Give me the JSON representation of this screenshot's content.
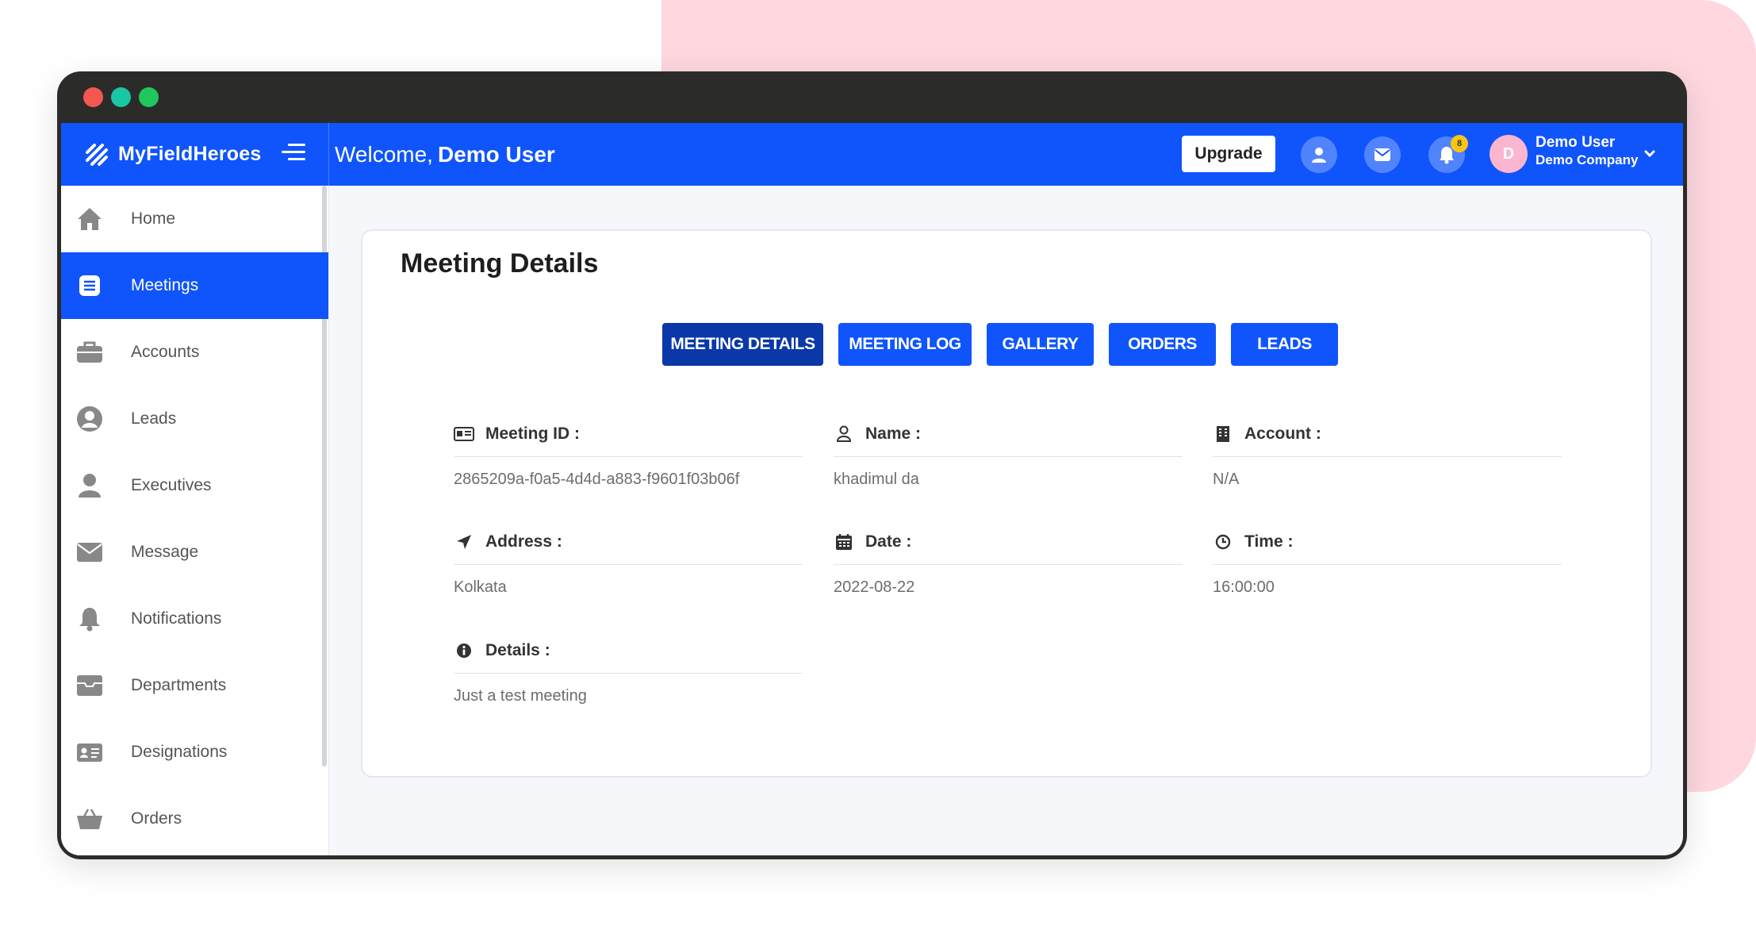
{
  "colors": {
    "brand_blue": "#0f55fb",
    "active_tab": "#0a38a8",
    "pink_bg": "#fed7df",
    "window_frame": "#2b2c2a",
    "badge": "#f9c514"
  },
  "window": {
    "traffic_lights": [
      "#f4574f",
      "#18c8a4",
      "#1fc85c"
    ]
  },
  "topbar": {
    "brand": "MyFieldHeroes",
    "welcome_prefix": "Welcome,",
    "welcome_name": "Demo User",
    "upgrade_label": "Upgrade",
    "icons": [
      "user-icon",
      "mail-icon",
      "bell-icon"
    ],
    "notification_count": "8",
    "avatar_initial": "D",
    "user_name": "Demo User",
    "company": "Demo Company"
  },
  "sidebar": {
    "items": [
      {
        "label": "Home",
        "icon": "home-icon"
      },
      {
        "label": "Meetings",
        "icon": "meetings-icon",
        "active": true
      },
      {
        "label": "Accounts",
        "icon": "briefcase-icon"
      },
      {
        "label": "Leads",
        "icon": "user-circle-icon"
      },
      {
        "label": "Executives",
        "icon": "person-icon"
      },
      {
        "label": "Message",
        "icon": "envelope-icon"
      },
      {
        "label": "Notifications",
        "icon": "bell-icon"
      },
      {
        "label": "Departments",
        "icon": "inbox-icon"
      },
      {
        "label": "Designations",
        "icon": "id-card-icon"
      },
      {
        "label": "Orders",
        "icon": "basket-icon"
      }
    ]
  },
  "main": {
    "title": "Meeting Details",
    "tabs": [
      "MEETING DETAILS",
      "MEETING LOG",
      "GALLERY",
      "ORDERS",
      "LEADS"
    ],
    "active_tab": "MEETING DETAILS",
    "fields": {
      "meeting_id": {
        "label": "Meeting ID :",
        "value": "2865209a-f0a5-4d4d-a883-f9601f03b06f"
      },
      "name": {
        "label": "Name :",
        "value": "khadimul da"
      },
      "account": {
        "label": "Account :",
        "value": "N/A"
      },
      "address": {
        "label": "Address :",
        "value": "Kolkata"
      },
      "date": {
        "label": "Date :",
        "value": "2022-08-22"
      },
      "time": {
        "label": "Time :",
        "value": "16:00:00"
      },
      "details": {
        "label": "Details :",
        "value": "Just a test meeting"
      }
    }
  }
}
